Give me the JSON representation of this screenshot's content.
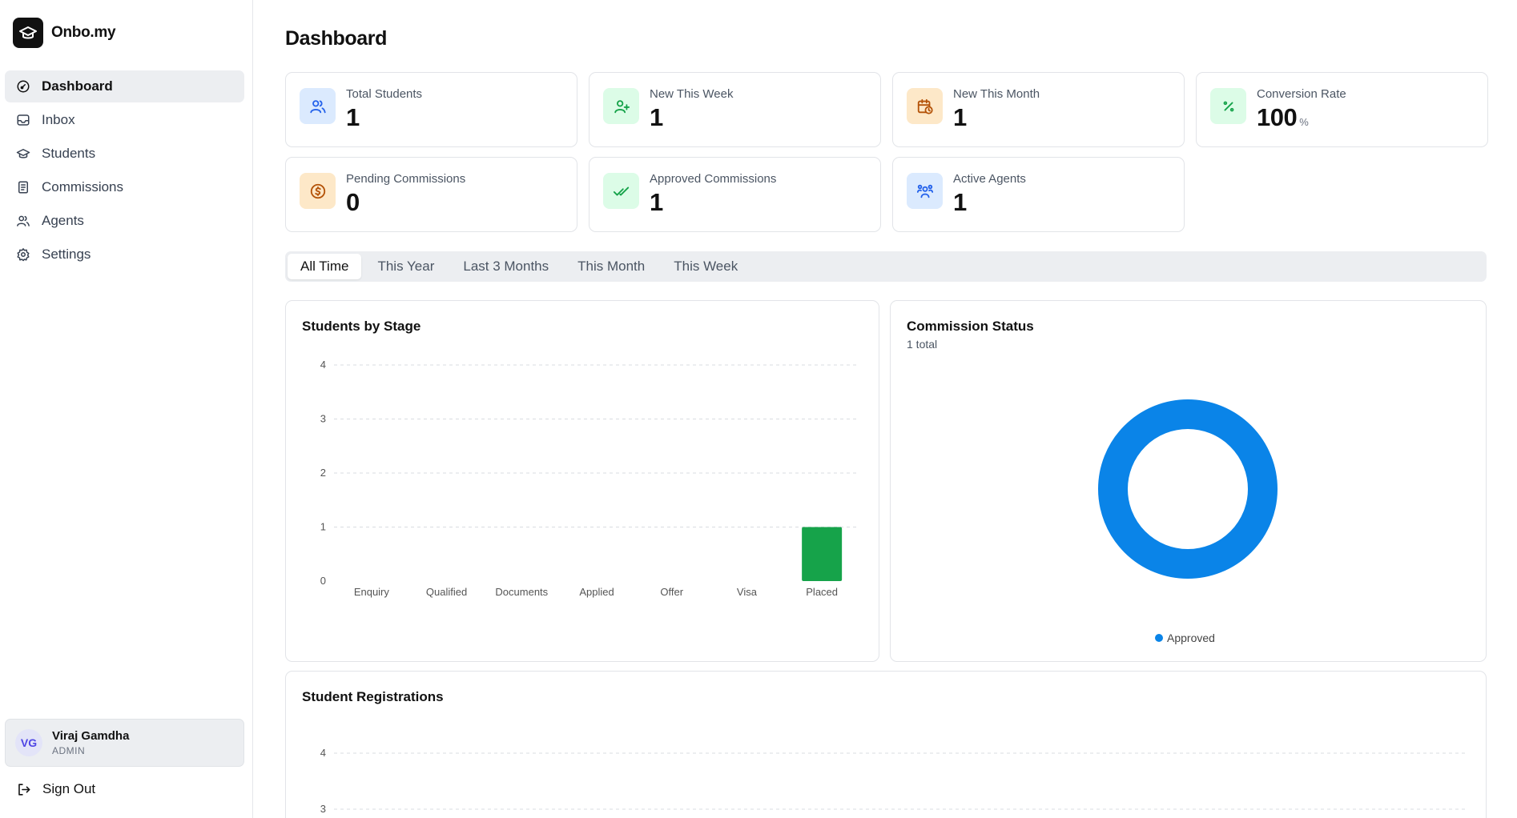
{
  "sidebar": {
    "brand": "Onbo.my",
    "nav": [
      {
        "label": "Dashboard",
        "icon": "dashboard-icon",
        "active": true
      },
      {
        "label": "Inbox",
        "icon": "inbox-icon"
      },
      {
        "label": "Students",
        "icon": "graduation-cap-icon"
      },
      {
        "label": "Commissions",
        "icon": "receipt-icon"
      },
      {
        "label": "Agents",
        "icon": "users-icon"
      },
      {
        "label": "Settings",
        "icon": "gear-icon"
      }
    ],
    "user": {
      "initials": "VG",
      "name": "Viraj Gamdha",
      "role": "ADMIN"
    },
    "signout": "Sign Out"
  },
  "header": {
    "title": "Dashboard"
  },
  "stats": [
    {
      "label": "Total Students",
      "value": "1",
      "icon": "users-icon",
      "color": "#dbeafe",
      "icon_color": "#2563eb"
    },
    {
      "label": "New This Week",
      "value": "1",
      "icon": "user-plus-icon",
      "color": "#dcfce7",
      "icon_color": "#16a34a"
    },
    {
      "label": "New This Month",
      "value": "1",
      "icon": "calendar-clock-icon",
      "color": "#fde8c8",
      "icon_color": "#b45309"
    },
    {
      "label": "Conversion Rate",
      "value": "100",
      "suffix": "%",
      "icon": "percent-icon",
      "color": "#dcfce7",
      "icon_color": "#16a34a"
    },
    {
      "label": "Pending Commissions",
      "value": "0",
      "icon": "dollar-circle-icon",
      "color": "#fde8c8",
      "icon_color": "#b45309"
    },
    {
      "label": "Approved Commissions",
      "value": "1",
      "icon": "double-check-icon",
      "color": "#dcfce7",
      "icon_color": "#16a34a"
    },
    {
      "label": "Active Agents",
      "value": "1",
      "icon": "team-icon",
      "color": "#dbeafe",
      "icon_color": "#2563eb"
    }
  ],
  "tabs": [
    "All Time",
    "This Year",
    "Last 3 Months",
    "This Month",
    "This Week"
  ],
  "active_tab": "All Time",
  "panels": {
    "stage": {
      "title": "Students by Stage"
    },
    "commission": {
      "title": "Commission Status",
      "subtitle": "1 total"
    },
    "registrations": {
      "title": "Student Registrations"
    }
  },
  "chart_data": [
    {
      "type": "bar",
      "title": "Students by Stage",
      "categories": [
        "Enquiry",
        "Qualified",
        "Documents",
        "Applied",
        "Offer",
        "Visa",
        "Placed"
      ],
      "values": [
        0,
        0,
        0,
        0,
        0,
        0,
        1
      ],
      "ylim": [
        0,
        4
      ],
      "yticks": [
        0,
        1,
        2,
        3,
        4
      ],
      "grid": true,
      "color": "#16a34a"
    },
    {
      "type": "pie",
      "title": "Commission Status",
      "labels": [
        "Approved"
      ],
      "values": [
        1
      ],
      "colors": [
        "#0a84e8"
      ],
      "legend": "bottom"
    },
    {
      "type": "line",
      "title": "Student Registrations",
      "yticks_visible": [
        3,
        4
      ],
      "grid": true
    }
  ]
}
